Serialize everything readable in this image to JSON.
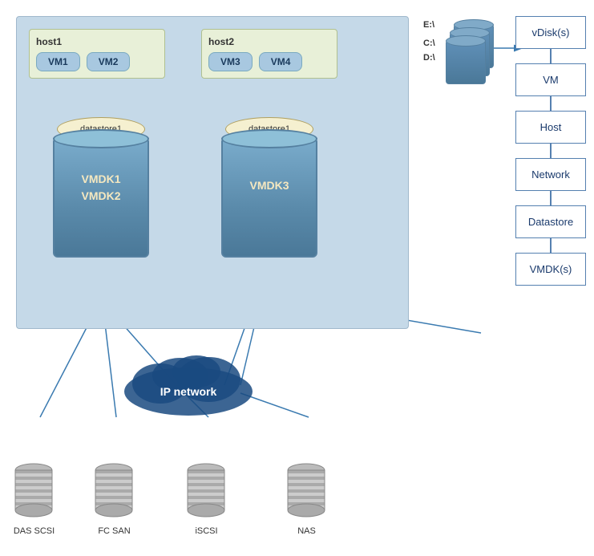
{
  "hosts": {
    "host1": {
      "label": "host1",
      "vms": [
        "VM1",
        "VM2"
      ]
    },
    "host2": {
      "label": "host2",
      "vms": [
        "VM3",
        "VM4"
      ]
    }
  },
  "datastores": {
    "ds1": {
      "label": "datastore1",
      "vmdks": [
        "VMDK1",
        "VMDK2"
      ]
    },
    "ds2": {
      "label": "datastore1",
      "vmdks": [
        "VMDK3"
      ]
    }
  },
  "hierarchy": [
    {
      "label": "vDisk(s)"
    },
    {
      "label": "VM"
    },
    {
      "label": "Host"
    },
    {
      "label": "Network"
    },
    {
      "label": "Datastore"
    },
    {
      "label": "VMDK(s)"
    }
  ],
  "vdisk_labels": [
    "E:\\",
    "C:\\",
    "D:\\"
  ],
  "storage_items": [
    {
      "label": "DAS SCSI"
    },
    {
      "label": "FC SAN"
    },
    {
      "label": "iSCSI"
    },
    {
      "label": "NAS"
    }
  ],
  "ip_network_label": "IP network"
}
